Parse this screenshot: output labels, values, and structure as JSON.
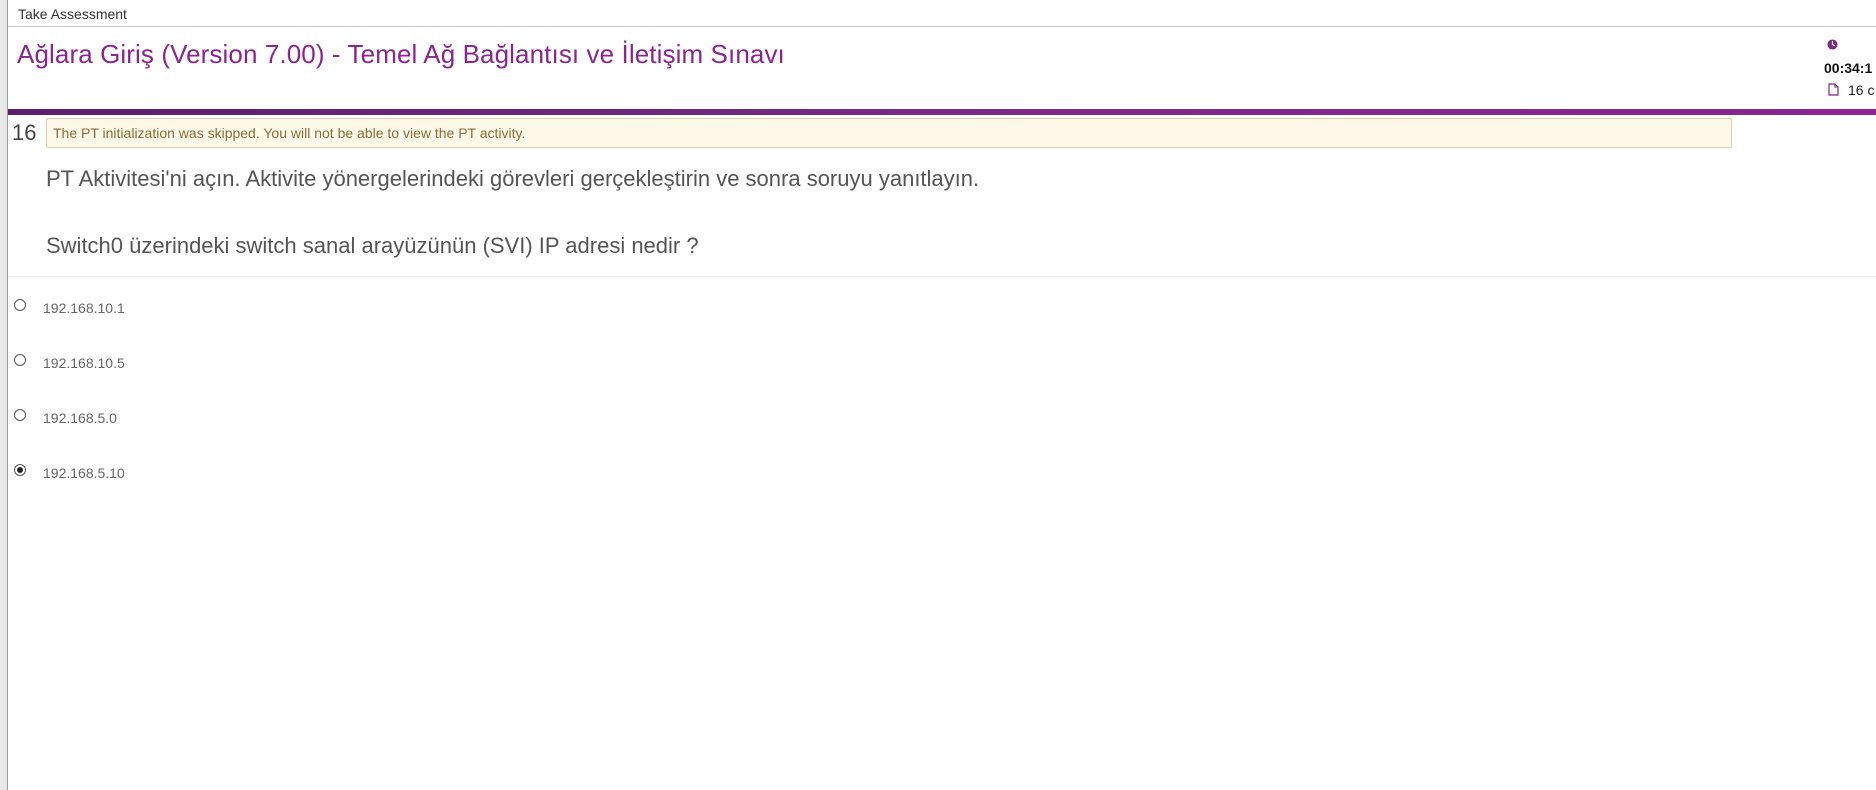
{
  "window": {
    "title": "Take Assessment"
  },
  "header": {
    "exam_title": "Ağlara Giriş (Version 7.00) - Temel Ağ Bağlantısı ve İletişim Sınavı",
    "timer": "00:34:1",
    "page_count": "16 c",
    "icons": {
      "timer": "clock-icon",
      "page": "document-icon"
    },
    "accent_color": "#8b2592"
  },
  "question": {
    "number": "16",
    "pt_notice": "The PT initialization was skipped. You will not be able to view the PT activity.",
    "instruction": "PT Aktivitesi'ni açın. Aktivite yönergelerindeki görevleri gerçekleştirin ve sonra soruyu yanıtlayın.",
    "prompt": "Switch0 üzerindeki switch sanal arayüzünün (SVI) IP adresi nedir ?"
  },
  "options": [
    {
      "label": "192.168.10.1",
      "selected": false
    },
    {
      "label": "192.168.10.5",
      "selected": false
    },
    {
      "label": "192.168.5.0",
      "selected": false
    },
    {
      "label": "192.168.5.10",
      "selected": true
    }
  ]
}
